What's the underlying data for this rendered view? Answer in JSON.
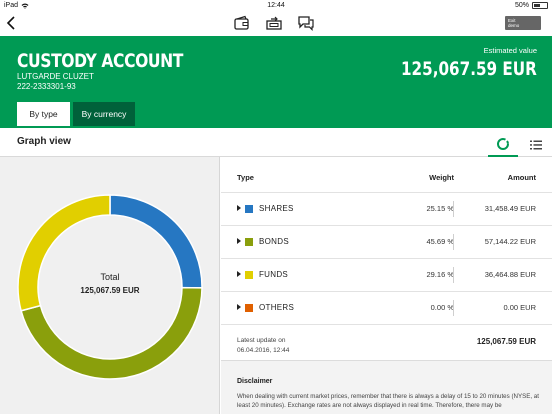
{
  "status_bar": {
    "device": "iPad",
    "time": "12:44",
    "battery": "50%"
  },
  "toolbar": {
    "exit_label_line1": "Exit",
    "exit_label_line2": "demo"
  },
  "header": {
    "title": "CUSTODY ACCOUNT",
    "holder_name": "LUTGARDE CLUZET",
    "account_number": "222-2333301-93",
    "estimated_label": "Estimated value",
    "estimated_value": "125,067.59 EUR",
    "tabs": [
      {
        "label": "By type",
        "active": true
      },
      {
        "label": "By currency",
        "active": false
      }
    ]
  },
  "graph_view": {
    "title": "Graph view",
    "chart_icon": "donut-chart-icon",
    "list_icon": "list-view-icon"
  },
  "chart_data": {
    "type": "pie",
    "center_label": "Total",
    "center_value": "125,067.59 EUR",
    "categories": [
      "SHARES",
      "BONDS",
      "FUNDS",
      "OTHERS"
    ],
    "values": [
      25.15,
      45.69,
      29.16,
      0.0
    ],
    "colors": [
      "#2677c2",
      "#8a9f0c",
      "#e1cf00",
      "#e06000"
    ]
  },
  "table": {
    "headers": {
      "type": "Type",
      "weight": "Weight",
      "amount": "Amount"
    },
    "rows": [
      {
        "label": "SHARES",
        "weight": "25.15 %",
        "amount": "31,458.49 EUR",
        "color": "#2677c2"
      },
      {
        "label": "BONDS",
        "weight": "45.69 %",
        "amount": "57,144.22 EUR",
        "color": "#8a9f0c"
      },
      {
        "label": "FUNDS",
        "weight": "29.16 %",
        "amount": "36,464.88 EUR",
        "color": "#e1cf00"
      },
      {
        "label": "OTHERS",
        "weight": "0.00 %",
        "amount": "0.00 EUR",
        "color": "#e06000"
      }
    ],
    "latest_update_label": "Latest update on",
    "latest_update_date": "06.04.2016, 12:44",
    "total": "125,067.59 EUR"
  },
  "disclaimer": {
    "title": "Disclaimer",
    "text": "When dealing with current market prices, remember that there is always a delay of 15 to 20 minutes (NYSE, at least 20 minutes). Exchange rates are not always displayed in real time. Therefore, there may be"
  },
  "colors": {
    "brand_green": "#009a54",
    "dark_green": "#00613a"
  }
}
